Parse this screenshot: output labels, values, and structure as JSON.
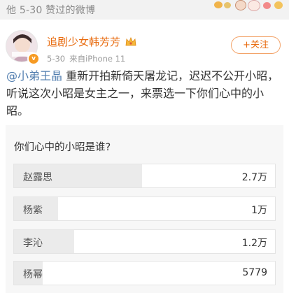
{
  "page": {
    "title": "他 5-30 赞过的微博"
  },
  "post": {
    "username": "追剧少女韩芳芳",
    "date": "5-30",
    "source": "来自iPhone 11",
    "follow_label": "+关注",
    "mention": "@小弟王晶",
    "text": " 重新开拍新倚天屠龙记，迟迟不公开小昭，听说这次小昭是女主之一，来票选一下你们心中的小昭。",
    "icons": {
      "verified": "verified-badge-icon",
      "crown": "crown-icon"
    }
  },
  "poll": {
    "question": "你们心中的小昭是谁?",
    "options": [
      {
        "label": "赵露思",
        "count": "2.7万",
        "share": 0.49
      },
      {
        "label": "杨紫",
        "count": "1万",
        "share": 0.17
      },
      {
        "label": "李沁",
        "count": "1.2万",
        "share": 0.23
      },
      {
        "label": "杨幂",
        "count": "5779",
        "share": 0.11
      }
    ]
  },
  "colors": {
    "accent": "#e86b0f",
    "mention": "#4f7cae",
    "poll_fill": "#ebebeb",
    "poll_bg": "#f7f7f7"
  }
}
